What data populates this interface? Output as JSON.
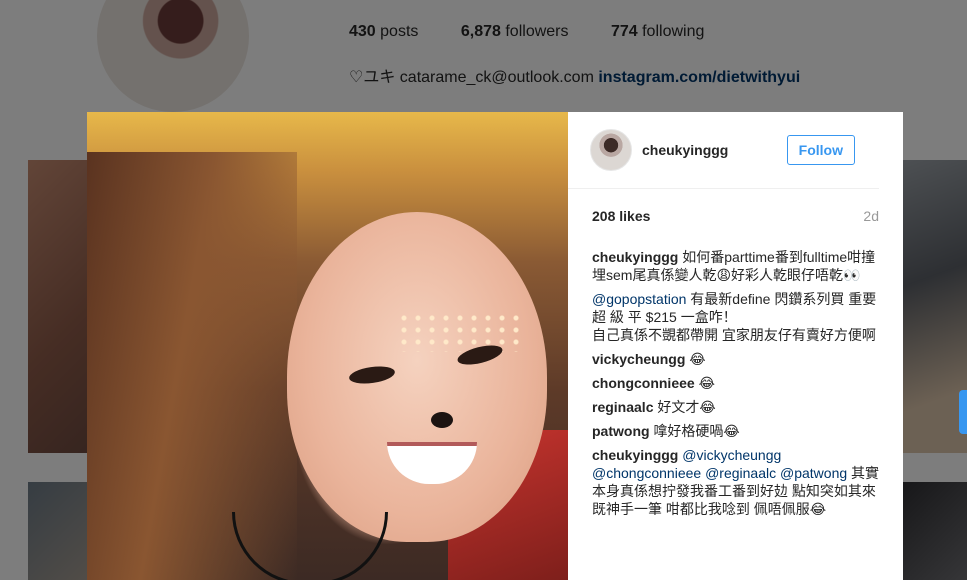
{
  "profile": {
    "posts_count": "430",
    "posts_label": "posts",
    "followers_count": "6,878",
    "followers_label": "followers",
    "following_count": "774",
    "following_label": "following",
    "bio_text": "♡ユキ catarame_ck@outlook.com",
    "bio_link": "instagram.com/dietwithyui"
  },
  "post": {
    "username": "cheukyinggg",
    "follow_label": "Follow",
    "likes": "208 likes",
    "age": "2d"
  },
  "comments": [
    {
      "author": "cheukyinggg",
      "text": "如何番parttime番到fulltime咁撞埋sem尾真係變人乾😩好彩人乾眼仔唔乾👀"
    },
    {
      "author": "",
      "mention": "@gopopstation",
      "text": " 有最新define 閃鑽系列買 重要超 級 平 $215 一盒咋！",
      "text2": "自己真係不覬都帶開 宜家朋友仔有賣好方便啊"
    },
    {
      "author": "vickycheungg",
      "text": "😂"
    },
    {
      "author": "chongconnieee",
      "text": "😂"
    },
    {
      "author": "reginaalc",
      "text": "好文才😂"
    },
    {
      "author": "patwong",
      "text": "嗱好格硬喎😂"
    },
    {
      "author": "cheukyinggg",
      "mention": "@vickycheungg",
      "mention2": "@chongconnieee",
      "mention3": "@reginaalc",
      "mention4": "@patwong",
      "text": "其實本身真係想拧發我番工番到好攰 點知突如其來既神手一筆 咁都比我唸到 佩唔佩服😂"
    }
  ],
  "colors": {
    "accent": "#3897f0",
    "link": "#003569",
    "muted": "#999999"
  }
}
